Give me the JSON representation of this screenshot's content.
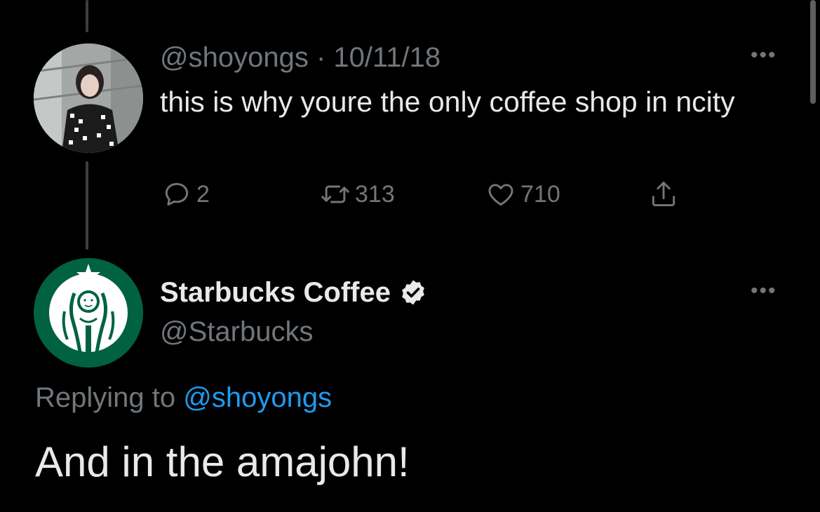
{
  "theme": {
    "background": "#000000",
    "text_primary": "#e7e9ea",
    "text_secondary": "#71767b",
    "link": "#1d9bf0",
    "brand_green": "#006241"
  },
  "original_tweet": {
    "handle": "@shoyongs",
    "separator": "·",
    "date": "10/11/18",
    "text": "this is why youre the only coffee shop in ncity",
    "avatar_icon": "profile-photo",
    "more_icon": "more-horizontal-icon",
    "more_label": "•••",
    "actions": {
      "reply": {
        "icon": "reply-icon",
        "count": "2"
      },
      "retweet": {
        "icon": "retweet-icon",
        "count": "313"
      },
      "like": {
        "icon": "heart-icon",
        "count": "710"
      },
      "share": {
        "icon": "share-icon"
      }
    }
  },
  "reply_tweet": {
    "display_name": "Starbucks Coffee",
    "verified_icon": "verified-badge-icon",
    "handle": "@Starbucks",
    "avatar_icon": "starbucks-siren-logo",
    "more_label": "•••",
    "replying_to_prefix": "Replying to",
    "replying_to_handle": "@shoyongs",
    "text": "And in the amajohn!"
  }
}
